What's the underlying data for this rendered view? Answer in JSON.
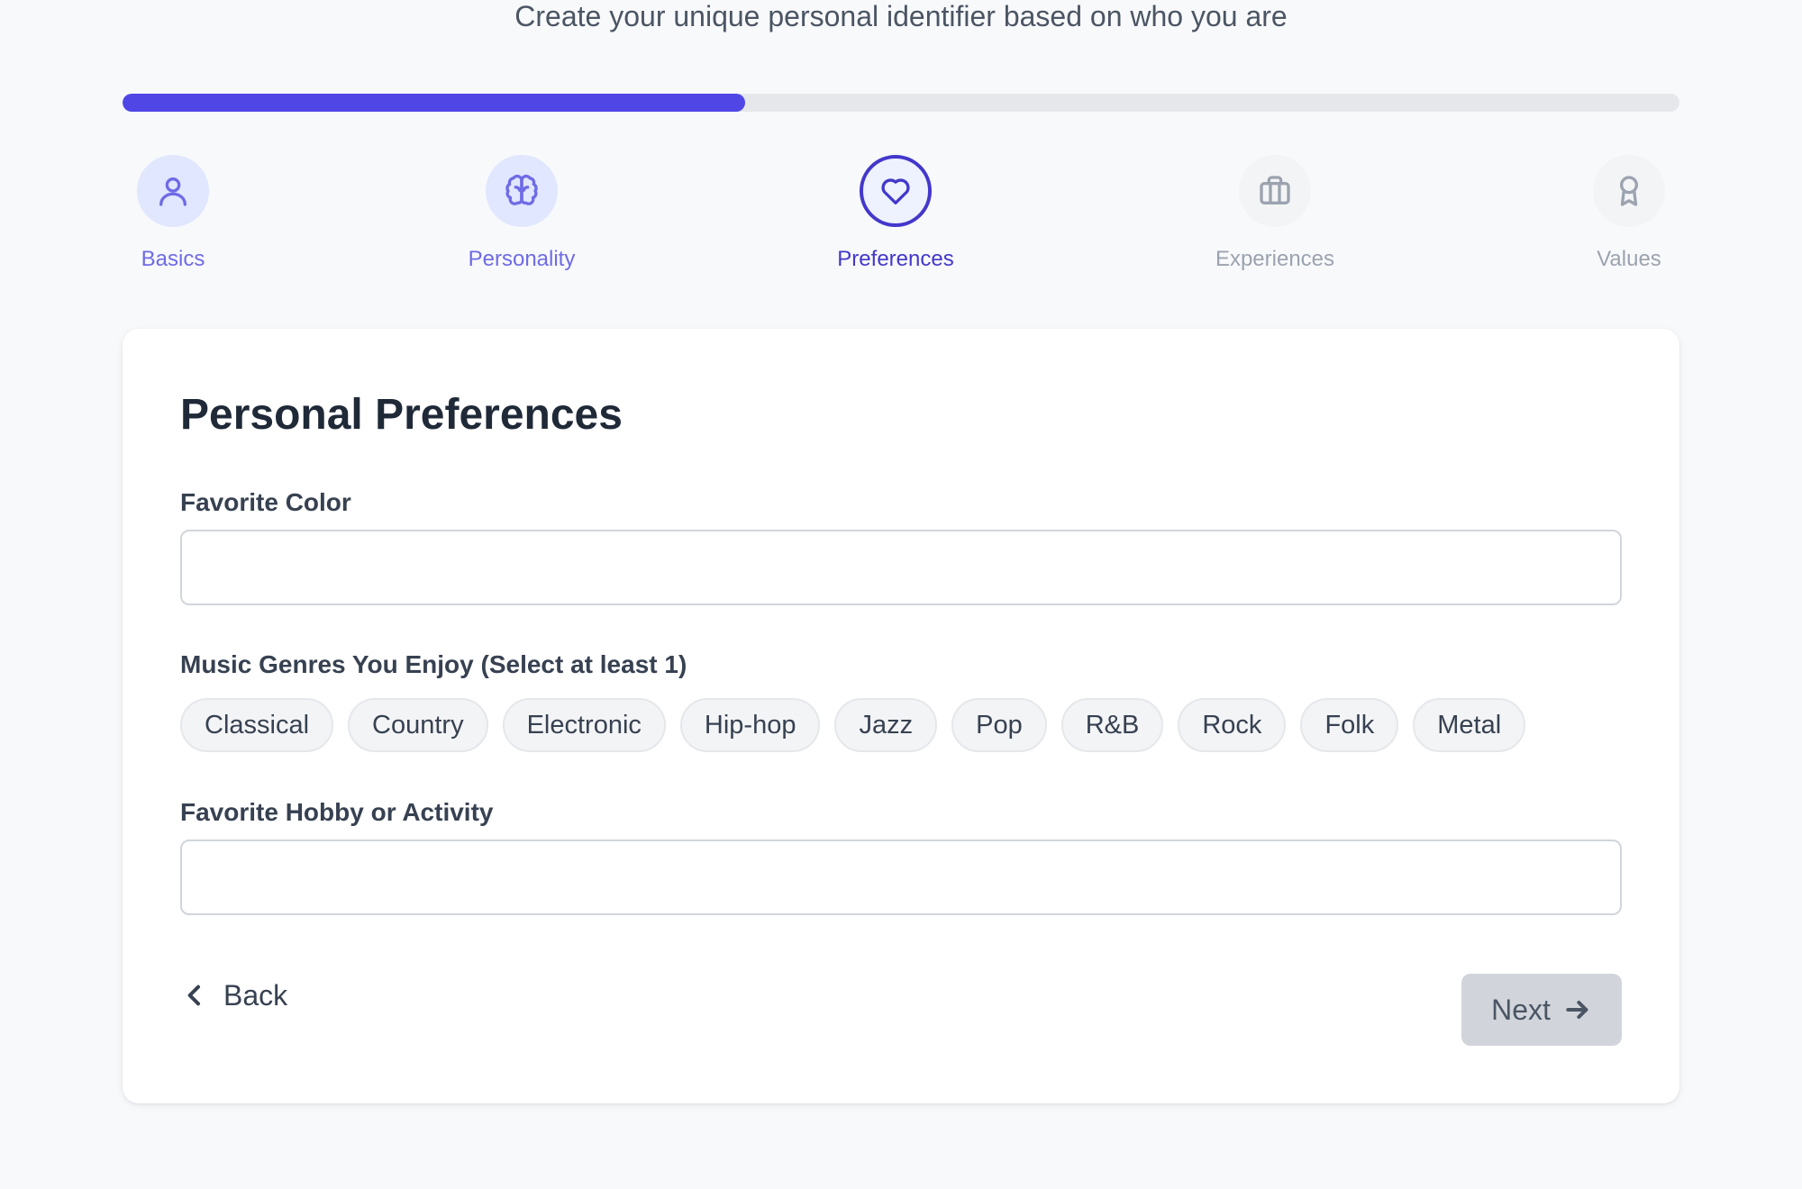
{
  "header": {
    "subtitle": "Create your unique personal identifier based on who you are"
  },
  "progress": {
    "fraction": 0.4
  },
  "steps": [
    {
      "label": "Basics",
      "icon": "user-icon",
      "state": "done"
    },
    {
      "label": "Personality",
      "icon": "brain-icon",
      "state": "done"
    },
    {
      "label": "Preferences",
      "icon": "heart-icon",
      "state": "active"
    },
    {
      "label": "Experiences",
      "icon": "briefcase-icon",
      "state": "todo"
    },
    {
      "label": "Values",
      "icon": "award-icon",
      "state": "todo"
    }
  ],
  "form": {
    "title": "Personal Preferences",
    "favorite_color": {
      "label": "Favorite Color",
      "value": ""
    },
    "music": {
      "label": "Music Genres You Enjoy (Select at least 1)",
      "genres": [
        "Classical",
        "Country",
        "Electronic",
        "Hip-hop",
        "Jazz",
        "Pop",
        "R&B",
        "Rock",
        "Folk",
        "Metal"
      ]
    },
    "hobby": {
      "label": "Favorite Hobby or Activity",
      "value": ""
    }
  },
  "nav": {
    "back_label": "Back",
    "next_label": "Next"
  },
  "colors": {
    "accent": "#4f46e5",
    "accent_dark": "#4338ca",
    "completed": "#6f6be6",
    "inactive": "#9ca3af",
    "disabled_button": "#d1d5db"
  }
}
